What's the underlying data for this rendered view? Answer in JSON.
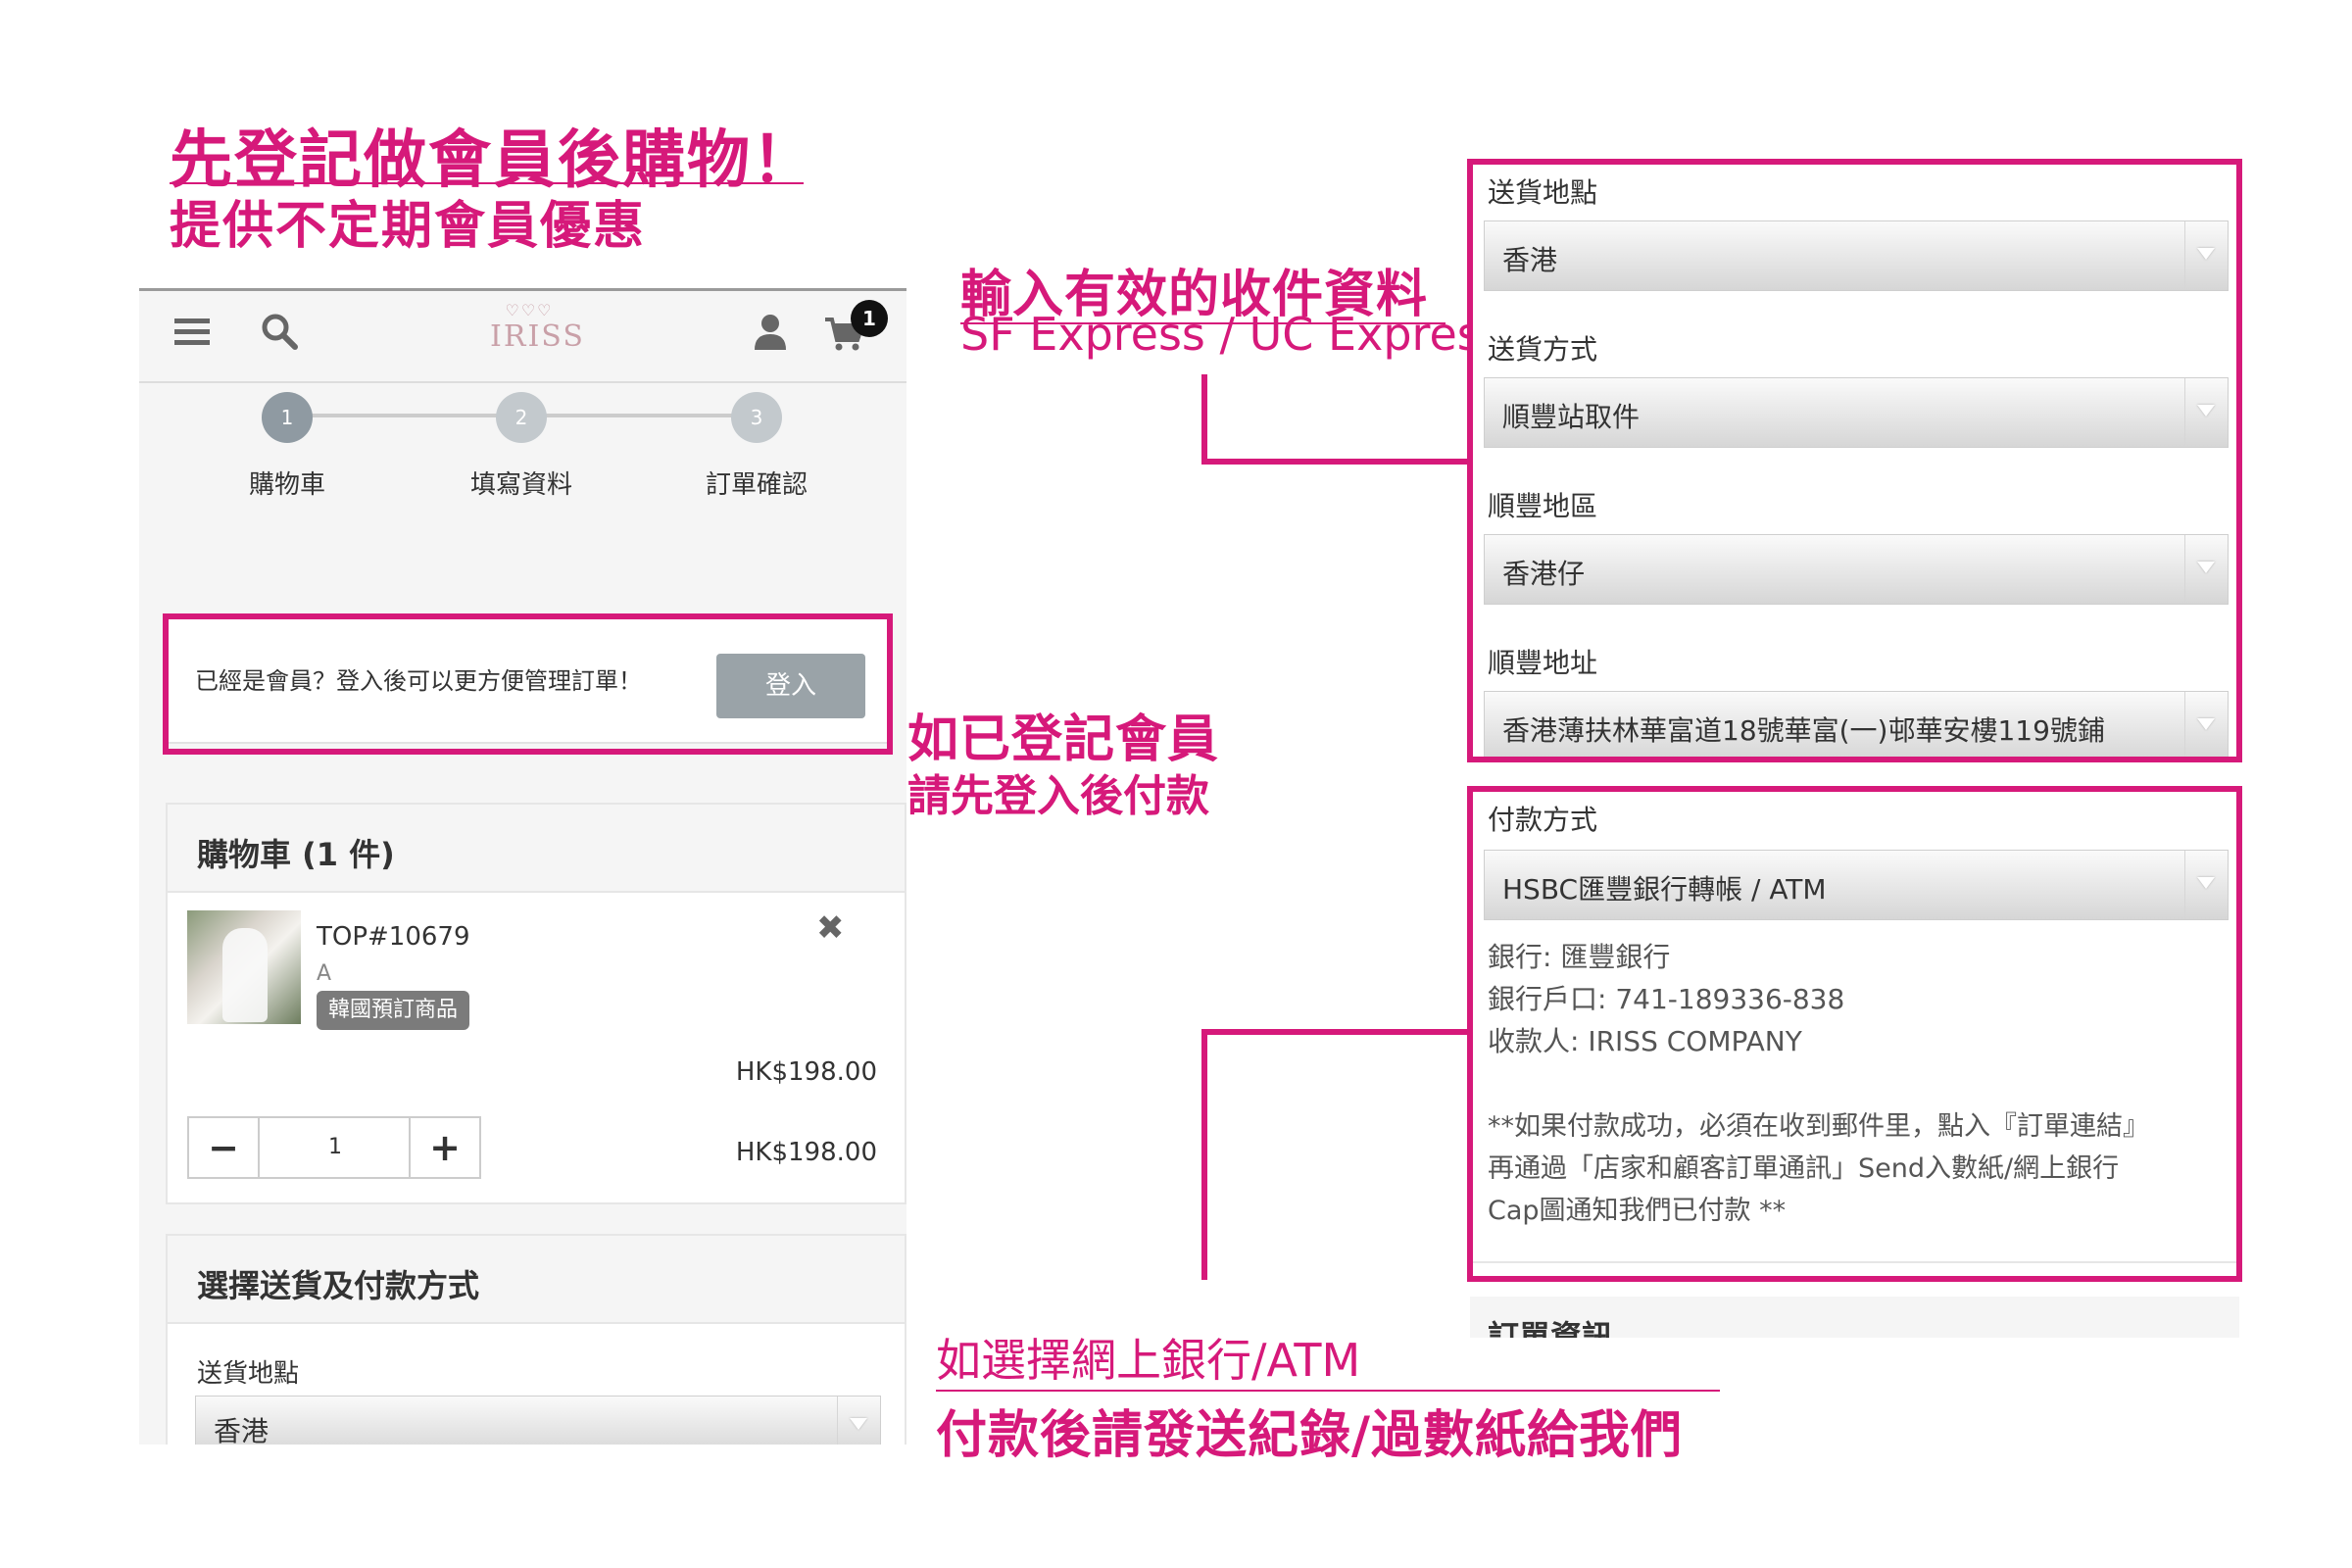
{
  "annotations": {
    "headline": "先登記做會員後購物！",
    "headline_sub": "提供不定期會員優惠",
    "shipping_note_title": "輸入有效的收件資料",
    "shipping_note_sub": "SF Express / UC Express",
    "member_note_title": "如已登記會員",
    "member_note_sub": "請先登入後付款",
    "bank_note_title": "如選擇網上銀行/ATM",
    "bank_note_sub": "付款後請發送紀錄/過數紙給我們"
  },
  "header": {
    "logo_hearts": "♡♡♡",
    "logo_text": "IRISS",
    "cart_count": "1"
  },
  "steps": [
    {
      "number": "1",
      "label": "購物車"
    },
    {
      "number": "2",
      "label": "填寫資料"
    },
    {
      "number": "3",
      "label": "訂單確認"
    }
  ],
  "login": {
    "prompt": "已經是會員？登入後可以更方便管理訂單！",
    "button_label": "登入"
  },
  "cart": {
    "title": "購物車 (1 件)",
    "item": {
      "name": "TOP#10679",
      "variant": "A",
      "tag": "韓國預訂商品",
      "unit_price": "HK$198.00",
      "quantity": "1",
      "subtotal": "HK$198.00",
      "qty_minus": "−",
      "qty_plus": "+",
      "remove": "✖"
    }
  },
  "delivery_section": {
    "title": "選擇送貨及付款方式",
    "location_label": "送貨地點",
    "location_value": "香港"
  },
  "shipping_panel": {
    "location_label": "送貨地點",
    "location_value": "香港",
    "method_label": "送貨方式",
    "method_value": "順豐站取件",
    "sf_area_label": "順豐地區",
    "sf_area_value": "香港仔",
    "sf_address_label": "順豐地址",
    "sf_address_value": "香港薄扶林華富道18號華富(一)邨華安樓119號鋪"
  },
  "payment_panel": {
    "method_label": "付款方式",
    "method_value": "HSBC匯豐銀行轉帳 / ATM",
    "bank_line": "銀行: 匯豐銀行",
    "account_line": "銀行戶口: 741-189336-838",
    "payee_line": "收款人: IRISS COMPANY",
    "note_line1": "**如果付款成功，必須在收到郵件里，點入『訂單連結』",
    "note_line2": "再通過「店家和顧客訂單通訊」Send入數紙/網上銀行",
    "note_line3": "Cap圖通知我們已付款 **",
    "next_section": "訂單資訊"
  },
  "colors": {
    "accent": "#d6197a",
    "step_active": "#8f9aa2",
    "step_inactive": "#c3c9cd",
    "button_gray": "#9aa3a8"
  }
}
